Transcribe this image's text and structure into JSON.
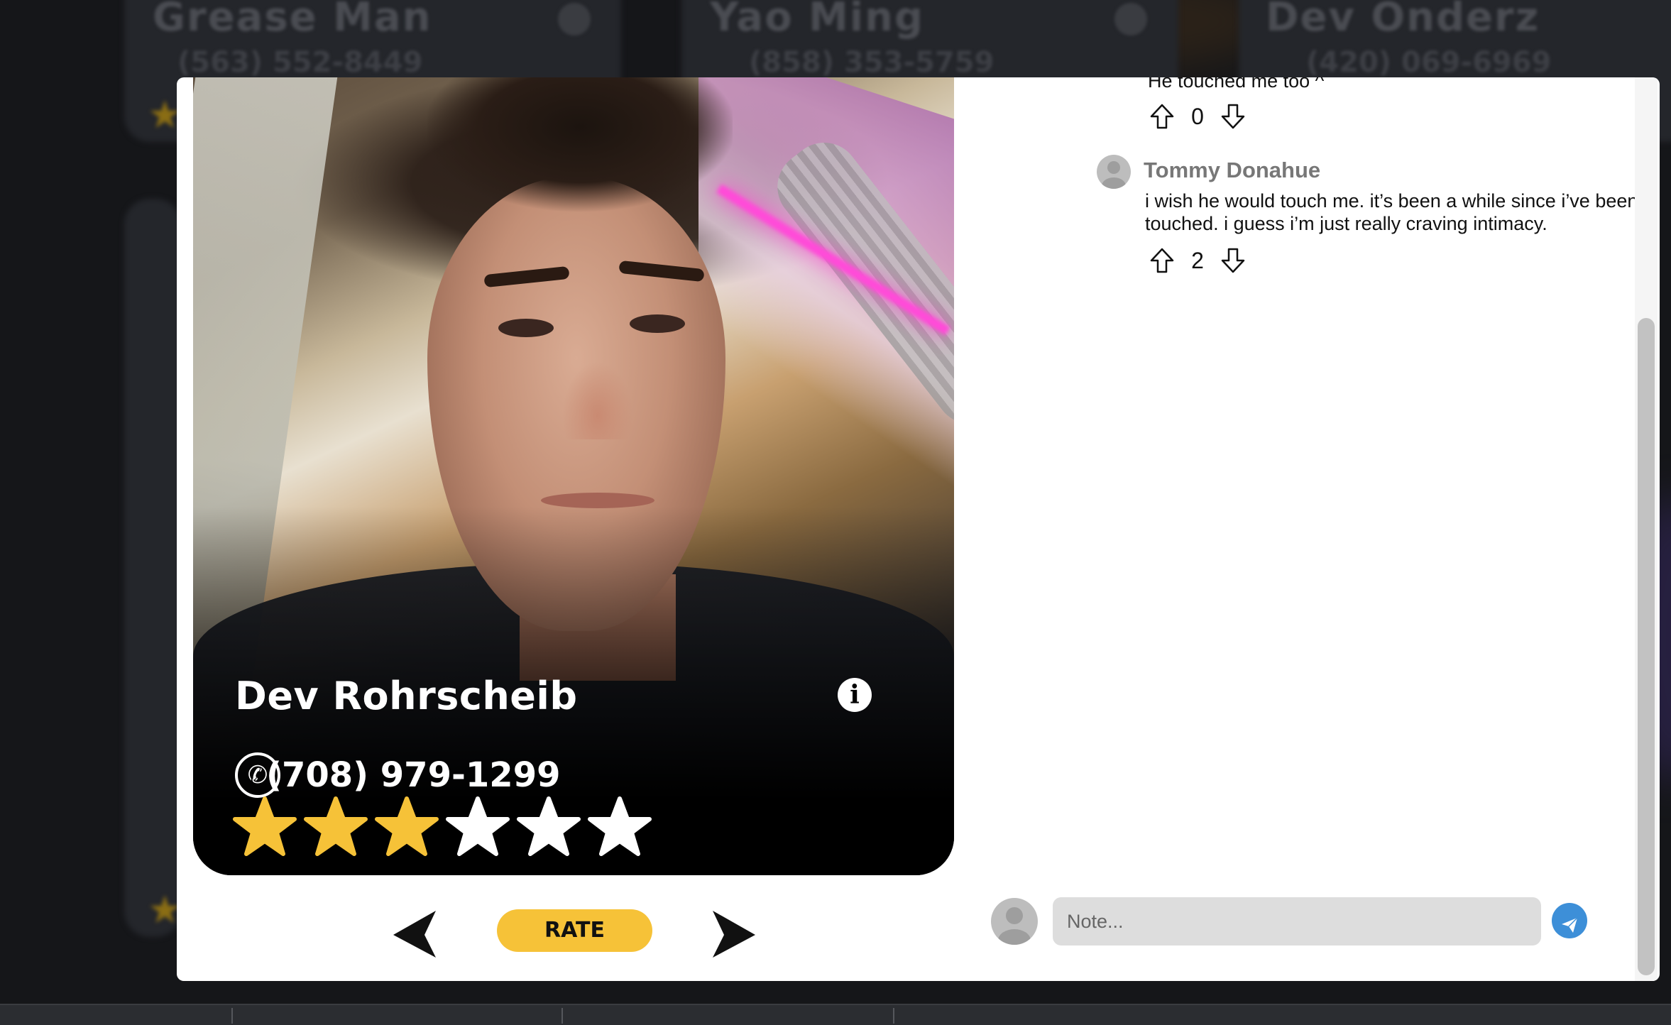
{
  "background": {
    "cards": [
      {
        "name": "Grease Man",
        "phone": "(563) 552-8449"
      },
      {
        "name": "Yao Ming",
        "phone": "(858) 353-5759"
      },
      {
        "name": "Dev Onderz",
        "phone": "(420) 069-6969"
      }
    ]
  },
  "profile": {
    "name": "Dev Rohrscheib",
    "phone": "(708) 979-1299",
    "rating": 3,
    "max_rating": 6,
    "rate_label": "RATE"
  },
  "comments": {
    "truncated_text": "He touched me too ^",
    "truncated_votes": "0",
    "items": [
      {
        "author": "Tommy Donahue",
        "text": "i wish he would touch me. it’s been a while since i’ve been touched. i guess i’m just really craving intimacy.",
        "votes": "2"
      }
    ]
  },
  "composer": {
    "placeholder": "Note..."
  },
  "colors": {
    "accent_yellow": "#f6c238",
    "send_blue": "#3d8fd8",
    "modal_bg": "#ffffff",
    "page_bg": "#1a1a1c"
  },
  "icons": {
    "info": "info-icon",
    "phone": "phone-icon",
    "star": "star-icon",
    "upvote": "arrow-up-outline-icon",
    "downvote": "arrow-down-outline-icon",
    "prev": "chevron-left-icon",
    "next": "chevron-right-icon",
    "send": "paper-plane-icon",
    "avatar": "user-avatar-icon"
  }
}
